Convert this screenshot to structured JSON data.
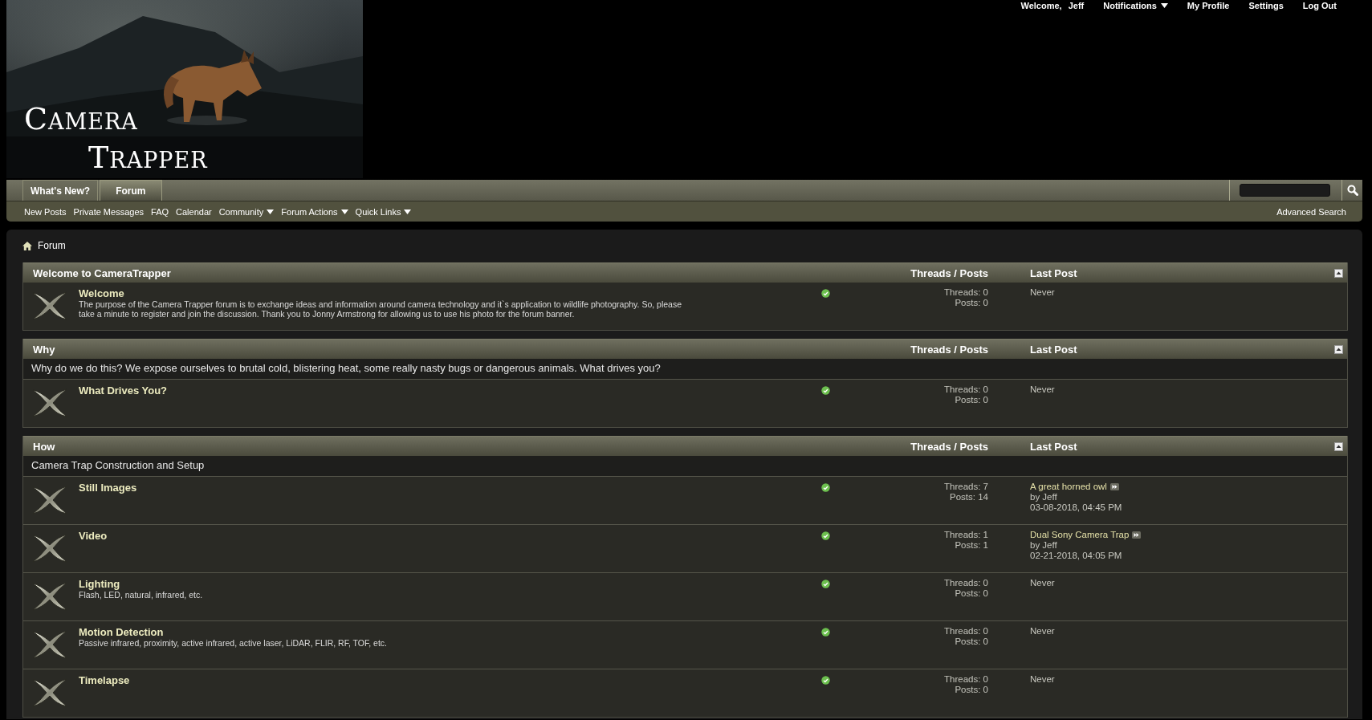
{
  "user_bar": {
    "welcome": "Welcome,",
    "user": "Jeff",
    "links": [
      {
        "label": "Notifications",
        "kind": "menu"
      },
      {
        "label": "My Profile",
        "kind": "link"
      },
      {
        "label": "Settings",
        "kind": "link"
      },
      {
        "label": "Log Out",
        "kind": "link"
      }
    ]
  },
  "logo": [
    "Camera",
    "Trapper"
  ],
  "tabs": [
    {
      "label": "What's New?",
      "selected": false
    },
    {
      "label": "Forum",
      "selected": true
    }
  ],
  "subnav": [
    {
      "label": "New Posts",
      "kind": "link"
    },
    {
      "label": "Private Messages",
      "kind": "link"
    },
    {
      "label": "FAQ",
      "kind": "link"
    },
    {
      "label": "Calendar",
      "kind": "link"
    },
    {
      "label": "Community",
      "kind": "menu"
    },
    {
      "label": "Forum Actions",
      "kind": "menu"
    },
    {
      "label": "Quick Links",
      "kind": "menu"
    }
  ],
  "advanced_search": "Advanced Search",
  "breadcrumb": "Forum",
  "sections": [
    {
      "title": "Welcome to CameraTrapper",
      "col_threads": "Threads / Posts",
      "col_last": "Last Post",
      "forums": [
        {
          "title": "Welcome",
          "description": "The purpose of the Camera Trapper forum is to exchange ideas and information around camera technology and it`s application to wildlife photography. So, please take a minute to register and join the discussion. Thank you to Jonny Armstrong for allowing us to use his photo for the forum banner.",
          "threads": "Threads: 0",
          "posts": "Posts: 0",
          "last_post": {
            "kind": "never",
            "text": "Never"
          }
        }
      ]
    },
    {
      "title": "Why",
      "col_threads": "Threads / Posts",
      "col_last": "Last Post",
      "description": "Why do we do this? We expose ourselves to brutal cold, blistering heat, some really nasty bugs or dangerous animals. What drives you?",
      "forums": [
        {
          "title": "What Drives You?",
          "threads": "Threads: 0",
          "posts": "Posts: 0",
          "last_post": {
            "kind": "never",
            "text": "Never"
          }
        }
      ]
    },
    {
      "title": "How",
      "col_threads": "Threads / Posts",
      "col_last": "Last Post",
      "description": "Camera Trap Construction and Setup",
      "forums": [
        {
          "title": "Still Images",
          "threads": "Threads: 7",
          "posts": "Posts: 14",
          "last_post": {
            "kind": "post",
            "title": "A great horned owl",
            "by": "by Jeff",
            "date": "03-08-2018, 04:45 PM"
          }
        },
        {
          "title": "Video",
          "threads": "Threads: 1",
          "posts": "Posts: 1",
          "last_post": {
            "kind": "post",
            "title": "Dual Sony Camera Trap",
            "by": "by Jeff",
            "date": "02-21-2018, 04:05 PM"
          }
        },
        {
          "title": "Lighting",
          "description": "Flash, LED, natural, infrared, etc.",
          "threads": "Threads: 0",
          "posts": "Posts: 0",
          "last_post": {
            "kind": "never",
            "text": "Never"
          }
        },
        {
          "title": "Motion Detection",
          "description": "Passive infrared, proximity, active infrared, active laser, LiDAR, FLIR, RF, TOF, etc.",
          "threads": "Threads: 0",
          "posts": "Posts: 0",
          "last_post": {
            "kind": "never",
            "text": "Never"
          }
        },
        {
          "title": "Timelapse",
          "threads": "Threads: 0",
          "posts": "Posts: 0",
          "last_post": {
            "kind": "never",
            "text": "Never"
          }
        }
      ]
    }
  ]
}
